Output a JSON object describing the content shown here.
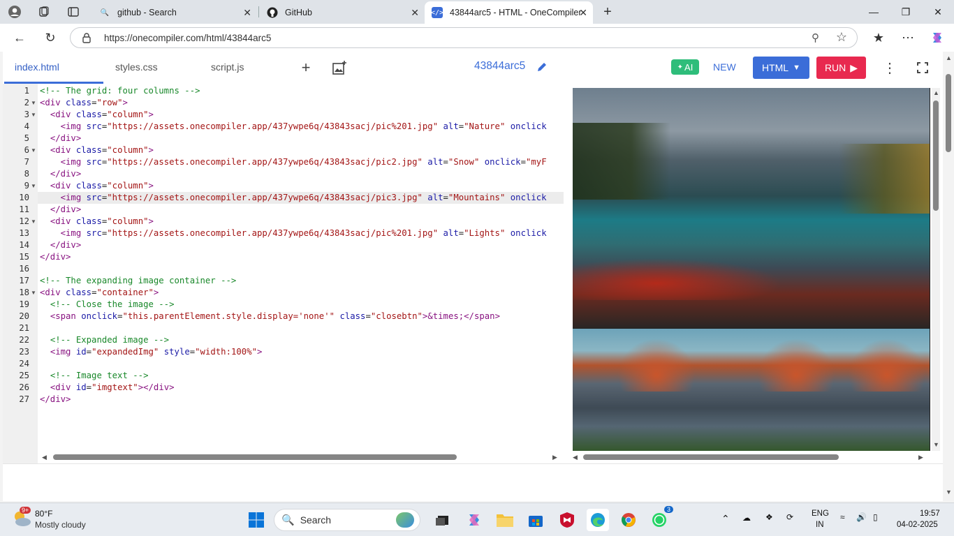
{
  "browser": {
    "tabs": [
      {
        "title": "github - Search",
        "icon": "search-icon"
      },
      {
        "title": "GitHub",
        "icon": "github-icon"
      },
      {
        "title": "43844arc5 - HTML - OneCompiler",
        "icon": "onecompiler-icon",
        "active": true
      }
    ],
    "url": "https://onecompiler.com/html/43844arc5"
  },
  "editor": {
    "file_tabs": [
      "index.html",
      "styles.css",
      "script.js"
    ],
    "project_name": "43844arc5",
    "ai_label": "AI",
    "new_label": "NEW",
    "lang_label": "HTML",
    "run_label": "RUN",
    "code_lines": [
      "<!-- The grid: four columns -->",
      "<div class=\"row\">",
      "  <div class=\"column\">",
      "    <img src=\"https://assets.onecompiler.app/437ywpe6q/43843sacj/pic%201.jpg\" alt=\"Nature\" onclick",
      "  </div>",
      "  <div class=\"column\">",
      "    <img src=\"https://assets.onecompiler.app/437ywpe6q/43843sacj/pic2.jpg\" alt=\"Snow\" onclick=\"myF",
      "  </div>",
      "  <div class=\"column\">",
      "    <img src=\"https://assets.onecompiler.app/437ywpe6q/43843sacj/pic3.jpg\" alt=\"Mountains\" onclick",
      "  </div>",
      "  <div class=\"column\">",
      "    <img src=\"https://assets.onecompiler.app/437ywpe6q/43843sacj/pic%201.jpg\" alt=\"Lights\" onclick",
      "  </div>",
      "</div>",
      "",
      "<!-- The expanding image container -->",
      "<div class=\"container\">",
      "  <!-- Close the image -->",
      "  <span onclick=\"this.parentElement.style.display='none'\" class=\"closebtn\">&times;</span>",
      "",
      "  <!-- Expanded image -->",
      "  <img id=\"expandedImg\" style=\"width:100%\">",
      "",
      "  <!-- Image text -->",
      "  <div id=\"imgtext\"></div>",
      "</div>"
    ],
    "current_line": 10
  },
  "taskbar": {
    "weather_temp": "80°F",
    "weather_desc": "Mostly cloudy",
    "weather_badge": "9+",
    "search_placeholder": "Search",
    "whatsapp_badge": "3",
    "lang": "ENG",
    "region": "IN",
    "time": "19:57",
    "date": "04-02-2025"
  }
}
